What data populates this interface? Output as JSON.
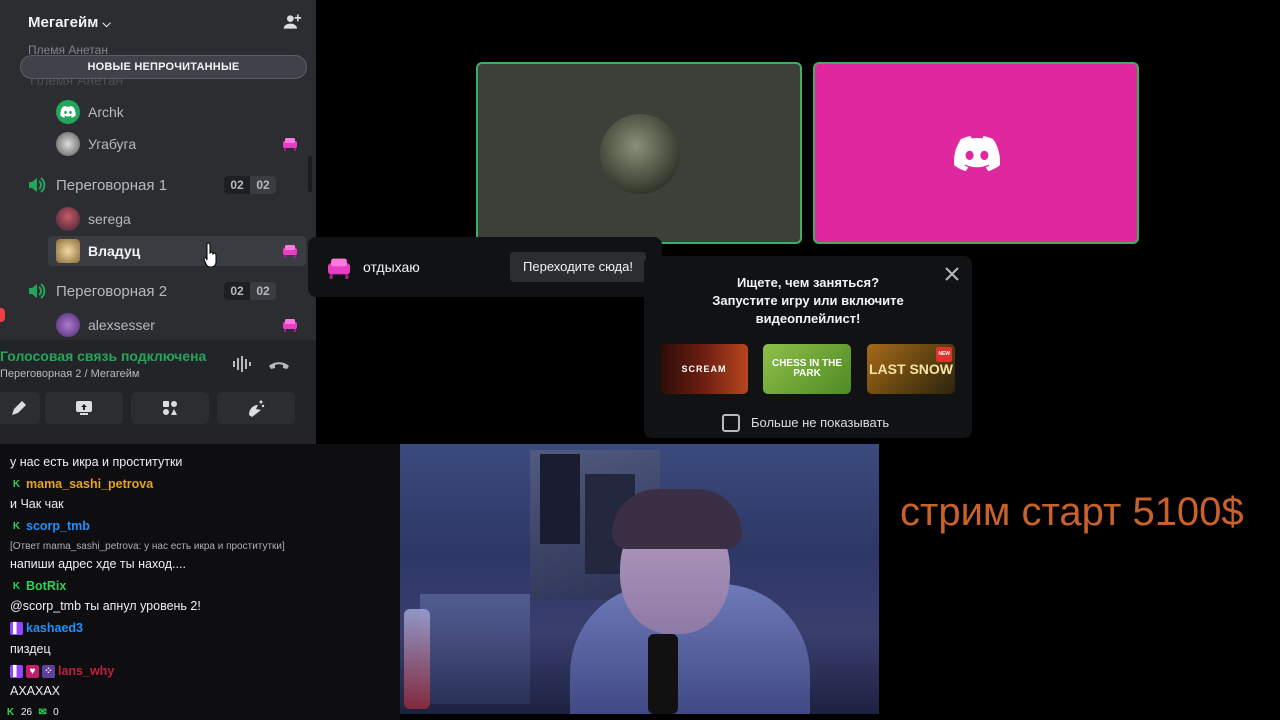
{
  "server": {
    "name": "Мегагейм",
    "faded_category": "Племя Анетан",
    "new_unread_label": "НОВЫЕ НЕПРОЧИТАННЫЕ"
  },
  "members_top": [
    {
      "name": "Archk"
    },
    {
      "name": "Угабуга"
    }
  ],
  "channels": [
    {
      "name": "Переговорная 1",
      "count_a": "02",
      "count_b": "02",
      "members": [
        {
          "name": "serega"
        },
        {
          "name": "Владуц"
        }
      ]
    },
    {
      "name": "Переговорная 2",
      "count_a": "02",
      "count_b": "02",
      "members": [
        {
          "name": "alexsesser"
        }
      ]
    }
  ],
  "voice_panel": {
    "status": "Голосовая связь подключена",
    "location": "Переговорная 2 / Мегагейм"
  },
  "activity_popup": {
    "activity": "отдыхаю",
    "button": "Переходите сюда!"
  },
  "suggestion": {
    "line1": "Ищете, чем заняться?",
    "line2": "Запустите игру или включите",
    "line3": "видеоплейлист!",
    "thumbs": [
      {
        "label": "SCREAM"
      },
      {
        "label": "CHESS IN THE PARK"
      },
      {
        "label": "LAST SNOW",
        "badge": "NEW"
      }
    ],
    "checkbox_label": "Больше не показывать"
  },
  "chat": {
    "lines": [
      {
        "type": "msg",
        "text": "у нас есть икра и проститутки"
      },
      {
        "type": "user",
        "name": "mama_sashi_petrova",
        "color": "#e8a317",
        "badges": [
          "mod"
        ]
      },
      {
        "type": "msg",
        "text": "и Чак чак"
      },
      {
        "type": "user",
        "name": "scorp_tmb",
        "color": "#1e90ff",
        "badges": [
          "mod"
        ]
      },
      {
        "type": "reply",
        "text": "[Ответ mama_sashi_petrova: у нас есть икра и проститутки]"
      },
      {
        "type": "msg",
        "text": "напиши адрес хде ты наход...."
      },
      {
        "type": "user",
        "name": "BotRix",
        "color": "#2bd356",
        "badges": [
          "mod"
        ]
      },
      {
        "type": "msg",
        "text": "@scorp_tmb ты апнул уровень 2!"
      },
      {
        "type": "user",
        "name": "kashaed3",
        "color": "#1e90ff",
        "badges": [
          "twitch"
        ]
      },
      {
        "type": "msg",
        "text": "пиздец"
      },
      {
        "type": "user",
        "name": "lans_why",
        "color": "#c0203c",
        "badges": [
          "twitch",
          "heart",
          "grid"
        ]
      },
      {
        "type": "msg",
        "text": "АХАХАХ"
      }
    ],
    "stats": {
      "mods": "26",
      "viewers": "0"
    }
  },
  "overlay": {
    "goal_text": "стрим старт 5100$",
    "goal_color": "#c9612b"
  },
  "colors": {
    "speaking_border": "#3fae5f",
    "discord_tile": "#e0289e",
    "voice_connected": "#23a55a"
  }
}
